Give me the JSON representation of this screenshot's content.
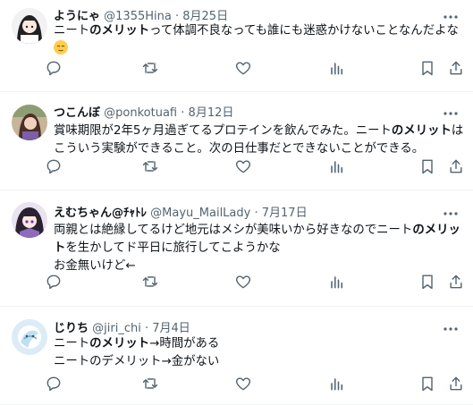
{
  "tweets": [
    {
      "name": "ようにゃ",
      "handle": "@1355Hina",
      "dot": "·",
      "date": "8月25日",
      "lines": [
        [
          {
            "t": "ニート"
          },
          {
            "t": "のメリット",
            "b": true
          },
          {
            "t": "って体調不良なっても誰にも迷惑かけないことなんだよな"
          }
        ]
      ]
    },
    {
      "name": "つこんぼ",
      "handle": "@ponkotuafi",
      "dot": "·",
      "date": "8月12日",
      "lines": [
        [
          {
            "t": "賞味期限が2年5ヶ月過ぎてるプロテインを飲んでみた。ニート"
          },
          {
            "t": "のメリット",
            "b": true
          },
          {
            "t": "は"
          }
        ],
        [
          {
            "t": "こういう実験ができること。次の日仕事だとできないことができる。"
          }
        ]
      ]
    },
    {
      "name": "えむちゃん@ﾁｬﾄﾚ",
      "handle": "@Mayu_MailLady",
      "dot": "·",
      "date": "7月17日",
      "lines": [
        [
          {
            "t": "両親とは絶縁してるけど地元はメシが美味いから好きなのでニート"
          },
          {
            "t": "のメリッ",
            "b": true
          }
        ],
        [
          {
            "t": "ト",
            "b": true
          },
          {
            "t": "を生かしてド平日に旅行してこようかな"
          }
        ],
        [
          {
            "t": "お金無いけど←"
          }
        ]
      ]
    },
    {
      "name": "じりち",
      "handle": "@jiri_chi",
      "dot": "·",
      "date": "7月4日",
      "lines": [
        [
          {
            "t": "ニート"
          },
          {
            "t": "のメリット",
            "b": true
          },
          {
            "t": "→時間がある"
          }
        ],
        [
          {
            "t": "ニートのデメリット→金がない"
          }
        ]
      ]
    }
  ],
  "icons": [
    "reply-icon",
    "retweet-icon",
    "like-icon",
    "views-icon",
    "bookmark-icon",
    "share-icon",
    "more-icon"
  ],
  "colors": {
    "text": "#0f1419",
    "muted": "#536471",
    "border": "#eff3f4"
  }
}
